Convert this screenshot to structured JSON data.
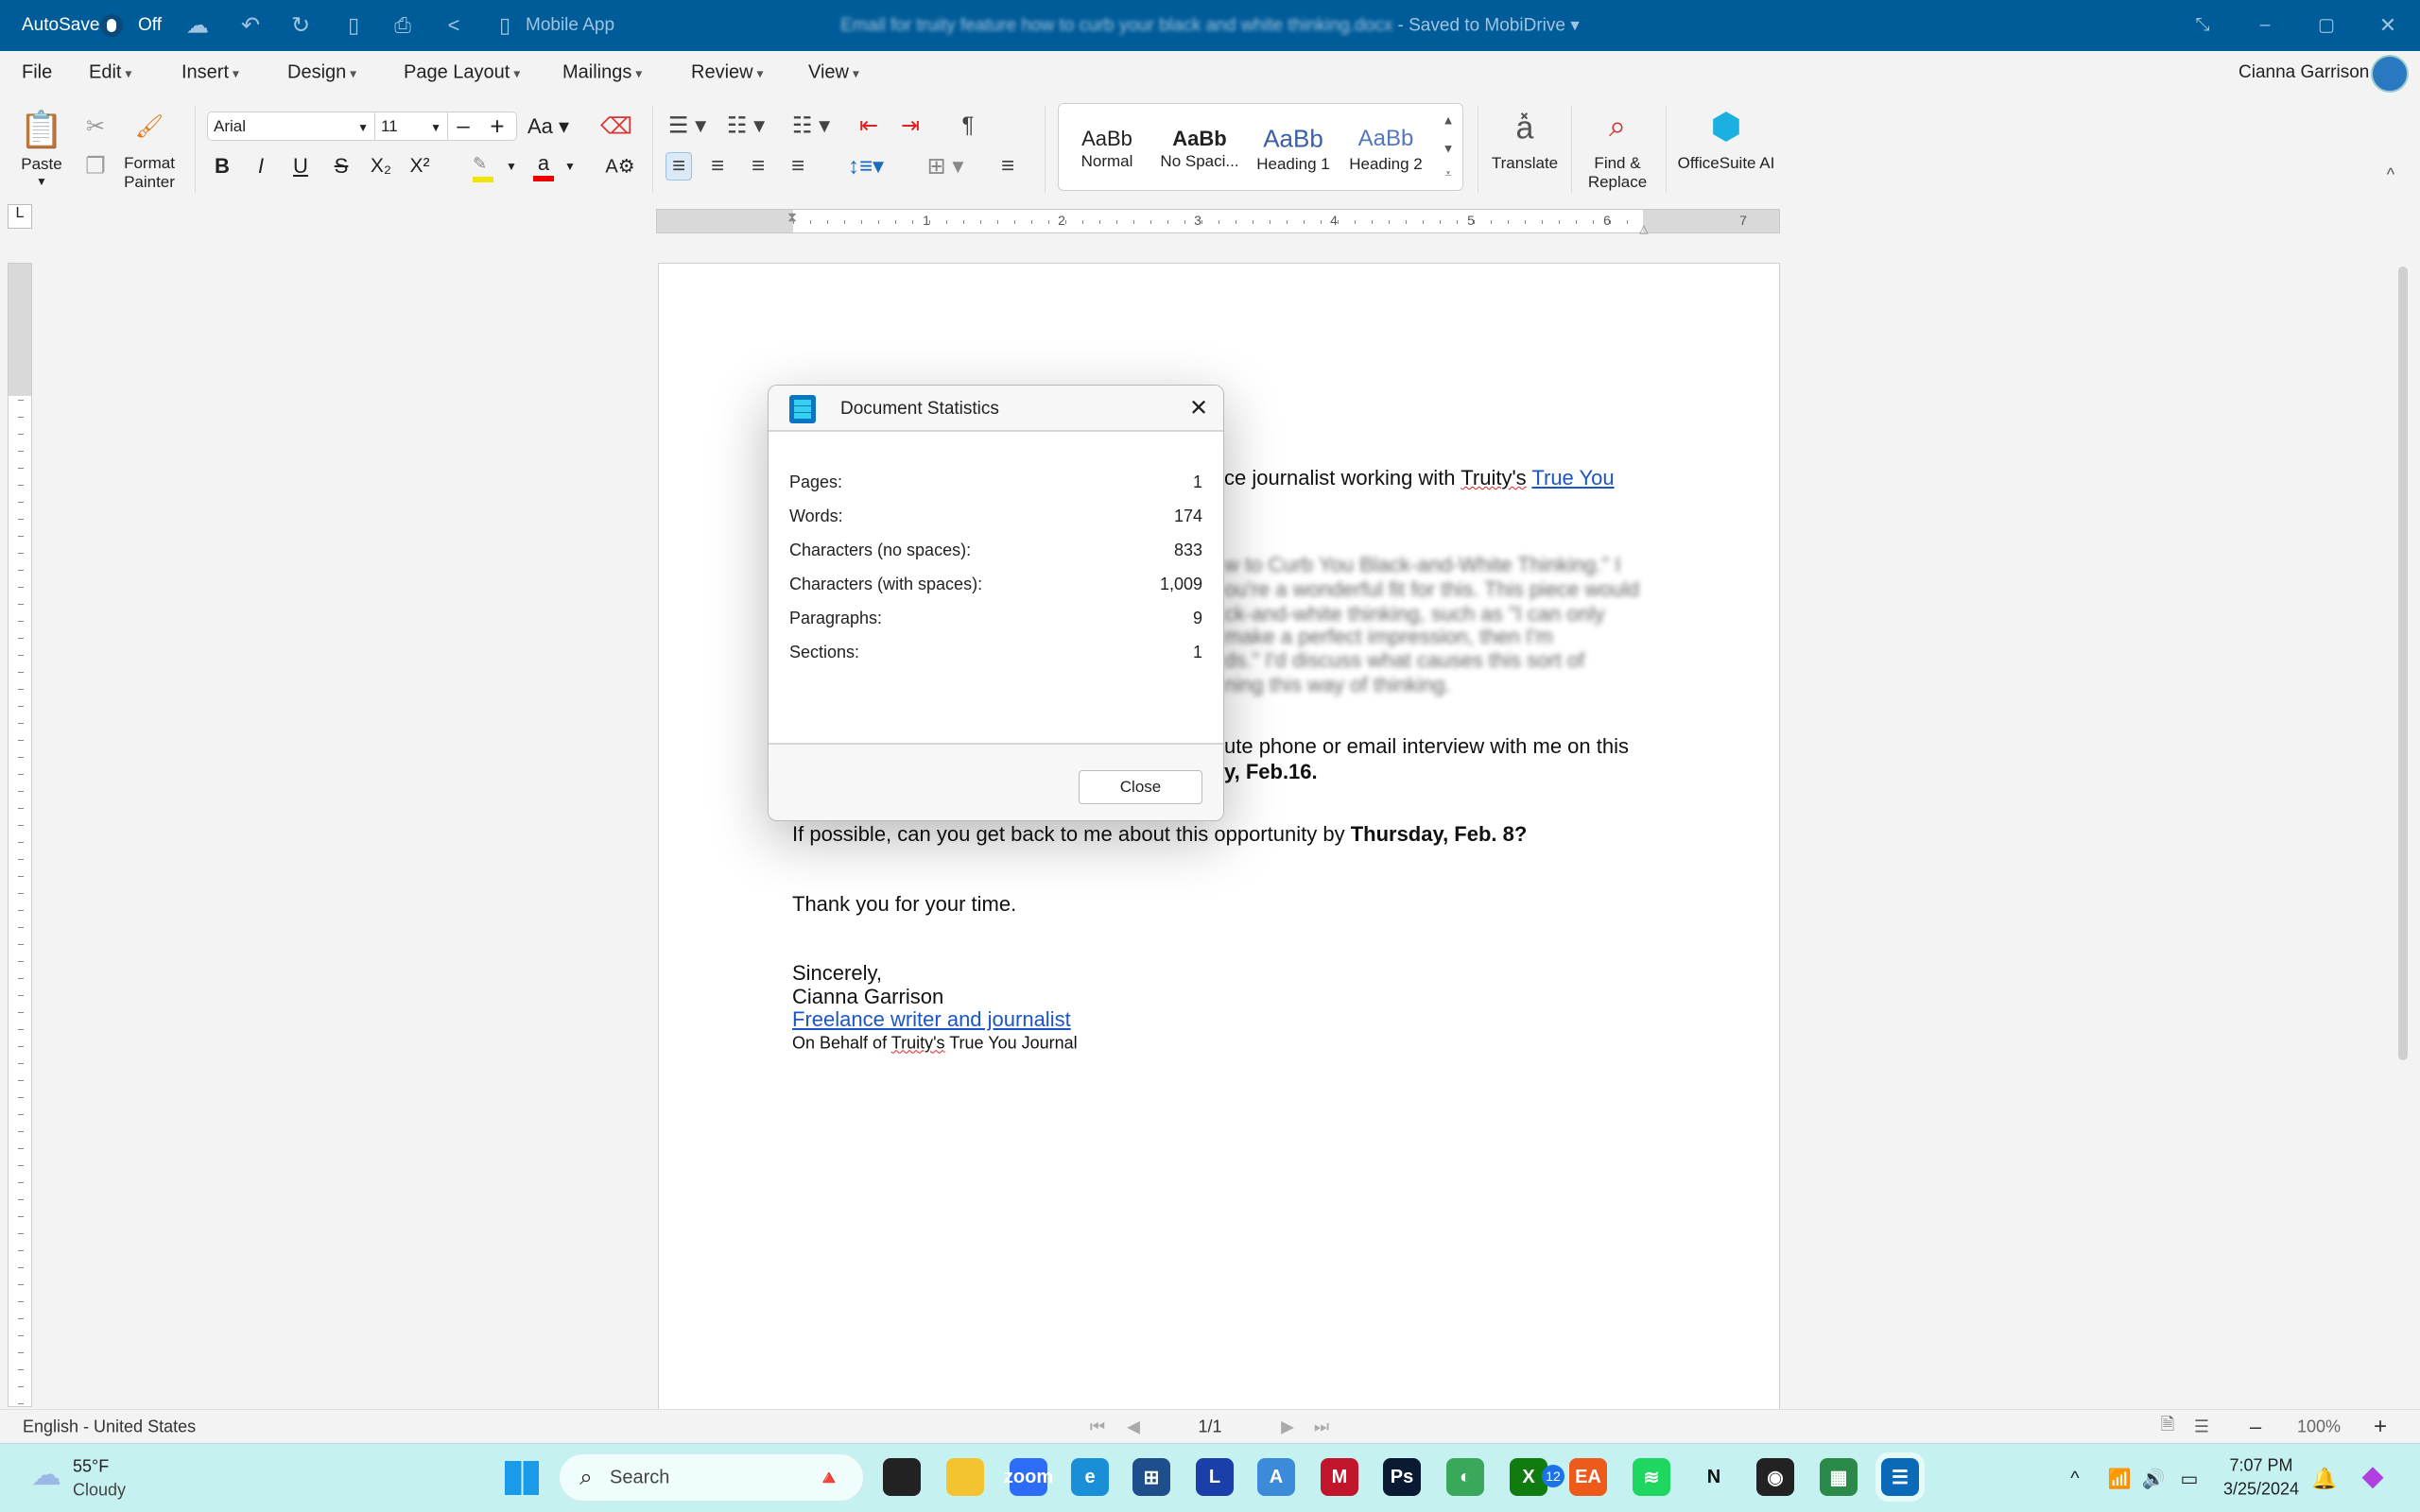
{
  "titlebar": {
    "autosave": "AutoSave",
    "autosave_state": "Off",
    "mobile_app": "Mobile App",
    "doc_title": "Email for truity feature how to curb your black and white thinking.docx",
    "saved": " - Saved to MobiDrive",
    "bg": "#005c99"
  },
  "menu": [
    "File",
    "Edit",
    "Insert",
    "Design",
    "Page Layout",
    "Mailings",
    "Review",
    "View"
  ],
  "user": {
    "name": "Cianna Garrison"
  },
  "ribbon": {
    "paste": "Paste",
    "format_painter_1": "Format",
    "format_painter_2": "Painter",
    "font": "Arial",
    "size": "11",
    "styles": [
      {
        "sample": "AaBb",
        "label": "Normal"
      },
      {
        "sample": "AaBb",
        "label": "No Spaci..."
      },
      {
        "sample": "AaBb",
        "label": "Heading 1"
      },
      {
        "sample": "AaBb",
        "label": "Heading 2"
      }
    ],
    "translate": "Translate",
    "find_1": "Find &",
    "find_2": "Replace",
    "ai": "OfficeSuite AI"
  },
  "ruler": {
    "labels": [
      "1",
      "2",
      "3",
      "4",
      "5",
      "6",
      "7"
    ]
  },
  "document": {
    "l1": "ce journalist working with ",
    "l1_truity": "Truity's",
    "l1_link": "True You ",
    "blurred": [
      "w to Curb You Black-and-White Thinking.\" I",
      "ou're a wonderful fit for this. This piece would",
      "ck-and-white thinking, such as \"I can only",
      "make a perfect impression, then I'm",
      "ds.\" I'd discuss what causes this sort of",
      "ning this way of thinking."
    ],
    "l3": "ute phone or email interview with me on this",
    "l4": "y, Feb.16.",
    "l5": "If possible, can you get back to me about this opportunity by ",
    "l5_bold": "Thursday, Feb. 8?",
    "l6": "Thank you for your time.",
    "l7": "Sincerely,",
    "l8": "Cianna Garrison",
    "l9": "Freelance writer and journalist",
    "l10_a": "On Behalf of ",
    "l10_truity": "Truity's",
    "l10_b": " True You Journal"
  },
  "dialog": {
    "title": "Document Statistics",
    "rows": [
      {
        "label": "Pages:",
        "value": "1"
      },
      {
        "label": "Words:",
        "value": "174"
      },
      {
        "label": "Characters (no spaces):",
        "value": "833"
      },
      {
        "label": "Characters (with spaces):",
        "value": "1,009"
      },
      {
        "label": "Paragraphs:",
        "value": "9"
      },
      {
        "label": "Sections:",
        "value": "1"
      }
    ],
    "close": "Close"
  },
  "status": {
    "language": "English - United States",
    "page": "1/1",
    "zoom": "100%"
  },
  "taskbar": {
    "temp": "55°F",
    "weather": "Cloudy",
    "search": "Search",
    "time": "7:07 PM",
    "date": "3/25/2024",
    "xbox_badge": "12",
    "apps": [
      {
        "name": "task-view",
        "label": "",
        "color": "#222"
      },
      {
        "name": "file-explorer",
        "label": "",
        "color": "#f4c430"
      },
      {
        "name": "zoom",
        "label": "zoom",
        "color": "#2d6cf6"
      },
      {
        "name": "edge",
        "label": "e",
        "color": "#1a8fd8"
      },
      {
        "name": "microsoft-store",
        "label": "⊞",
        "color": "#1e4e8c"
      },
      {
        "name": "l-app",
        "label": "L",
        "color": "#1b3fa8"
      },
      {
        "name": "affinity",
        "label": "A",
        "color": "#3c8bd8"
      },
      {
        "name": "mcafee",
        "label": "M",
        "color": "#c0152b"
      },
      {
        "name": "photoshop",
        "label": "Ps",
        "color": "#0b1a33"
      },
      {
        "name": "maps-app",
        "label": "◐",
        "color": "#3aa85a"
      },
      {
        "name": "xbox",
        "label": "X",
        "color": "#107c10"
      },
      {
        "name": "ea",
        "label": "EA",
        "color": "#ee5a1a"
      },
      {
        "name": "spotify",
        "label": "≋",
        "color": "#1ed760"
      },
      {
        "name": "n-app",
        "label": "N",
        "color": "#c6f1f1"
      },
      {
        "name": "nvidia",
        "label": "◉",
        "color": "#222"
      },
      {
        "name": "sheets",
        "label": "▦",
        "color": "#2b8a4a"
      },
      {
        "name": "officesuite",
        "label": "☰",
        "color": "#0a6ab8"
      }
    ]
  }
}
